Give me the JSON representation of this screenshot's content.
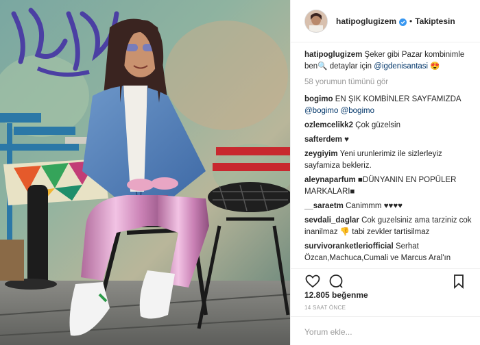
{
  "header": {
    "username": "hatipoglugizem",
    "separator": "•",
    "follow_label": "Takiptesin",
    "verified_icon": "verified-badge-icon"
  },
  "caption": {
    "user": "hatipoglugizem",
    "text": "Şeker gibi Pazar kombinimle ben🔍 detaylar için",
    "mention": "@igdenisantasi",
    "emoji": "😍"
  },
  "view_all": "58 yorumun tümünü gör",
  "comments": [
    {
      "user": "bogimo",
      "text": "EN ŞIK KOMBİNLER SAYFAMIZDA",
      "mention": "@bogimo @bogimo"
    },
    {
      "user": "ozlemcelikk2",
      "text": "Çok güzelsin",
      "mention": ""
    },
    {
      "user": "safterdem",
      "text": "♥",
      "mention": ""
    },
    {
      "user": "zeygiyim",
      "text": "Yeni urunlerimiz ile sizlerleyiz sayfamiza bekleriz.",
      "mention": ""
    },
    {
      "user": "aleynaparfum",
      "text": "■DÜNYANIN EN POPÜLER MARKALARI■",
      "mention": ""
    },
    {
      "user": "__saraetm",
      "text": "Canimmm ♥♥♥♥",
      "mention": ""
    },
    {
      "user": "sevdali_daglar",
      "text": "Cok guzelsiniz ama tarziniz cok inanilmaz 👎 tabi zevkler tartisilmaz",
      "mention": ""
    },
    {
      "user": "survivoranketleriofficial",
      "text": "Serhat Özcan,Machuca,Cumali ve Marcus Aral'ın",
      "mention": ""
    }
  ],
  "actions": {
    "like_icon": "heart-icon",
    "comment_icon": "comment-icon",
    "save_icon": "bookmark-icon"
  },
  "likes": "12.805 beğenme",
  "time_ago": "14 SAAT ÖNCE",
  "add_comment_placeholder": "Yorum ekle...",
  "colors": {
    "text": "#262626",
    "mention": "#003569",
    "muted": "#999999",
    "verified": "#3897f0",
    "border": "#efefef"
  }
}
